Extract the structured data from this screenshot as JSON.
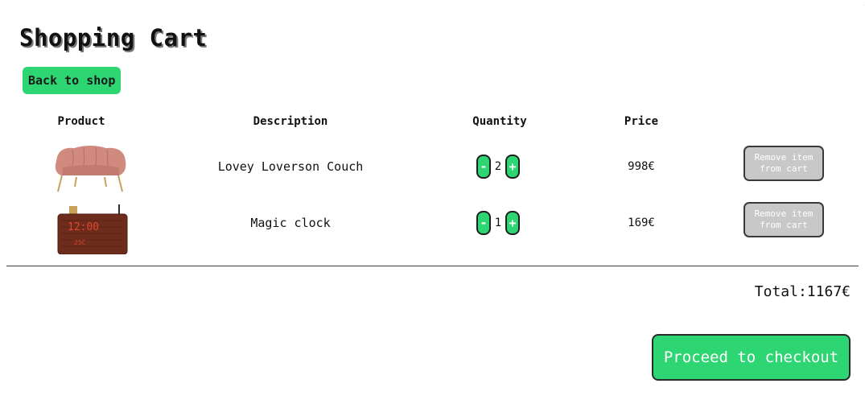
{
  "page": {
    "title": "Shopping Cart",
    "back_label": "Back to shop"
  },
  "table": {
    "headers": {
      "product": "Product",
      "description": "Description",
      "quantity": "Quantity",
      "price": "Price"
    },
    "items": [
      {
        "image_icon": "pink-velvet-sofa-image",
        "description": "Lovey Loverson Couch",
        "decrement_label": "-",
        "quantity": "2",
        "increment_label": "+",
        "price": "998€",
        "remove_label": "Remove item from cart"
      },
      {
        "image_icon": "wooden-led-clock-image",
        "description": "Magic clock",
        "decrement_label": "-",
        "quantity": "1",
        "increment_label": "+",
        "price": "169€",
        "remove_label": "Remove item from cart"
      }
    ]
  },
  "summary": {
    "total": "Total:1167€",
    "checkout_label": "Proceed to checkout"
  },
  "colors": {
    "accent_green": "#2ed573",
    "remove_button_gray": "#c8c8c8"
  }
}
